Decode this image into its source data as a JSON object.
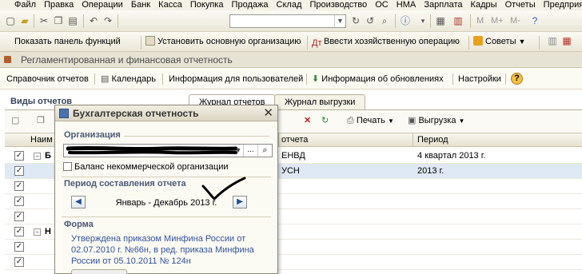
{
  "menu": [
    "Файл",
    "Правка",
    "Операции",
    "Банк",
    "Касса",
    "Покупка",
    "Продажа",
    "Склад",
    "Производство",
    "ОС",
    "НМА",
    "Зарплата",
    "Кадры",
    "Отчеты",
    "Предприятие"
  ],
  "toolbar1": {
    "icons": [
      "new-doc-icon",
      "open-icon",
      "cut-icon",
      "copy-icon",
      "paste-icon",
      "undo-icon",
      "redo-icon",
      "search-next-icon",
      "search-prev-icon",
      "search-icon",
      "info-icon",
      "calculator-icon",
      "calendar-icon",
      "m-icon",
      "m-plus-icon",
      "m-minus-icon",
      "help-icon"
    ],
    "labels": {
      "m": "M",
      "m_plus": "M+",
      "m_minus": "M-"
    },
    "search_value": ""
  },
  "toolbar2": {
    "show_panel": "Показать панель функций",
    "set_org": "Установить основную организацию",
    "enter_op": "Ввести хозяйственную операцию",
    "tips": "Советы"
  },
  "window_title": "Регламентированная и финансовая отчетность",
  "formbar": {
    "directory": "Справочник отчетов",
    "calendar": "Календарь",
    "user_info": "Информация для пользователей",
    "updates": "Информация об обновлениях",
    "settings": "Настройки"
  },
  "section_title": "Виды отчетов",
  "tabs": [
    "Журнал отчетов",
    "Журнал выгрузки"
  ],
  "listbar": {
    "print": "Печать",
    "export": "Выгрузка"
  },
  "grid": {
    "headers": {
      "name": "Наим",
      "report": "отчета",
      "period": "Период"
    },
    "rows": [
      {
        "group_prefix": "Б",
        "report": "ЕНВД",
        "period": "4 квартал 2013 г."
      },
      {
        "group_prefix": "",
        "report": "УСН",
        "period": "2013 г."
      },
      {
        "group_prefix": "",
        "report": "",
        "period": ""
      },
      {
        "group_prefix": "",
        "report": "",
        "period": ""
      },
      {
        "group_prefix": "Н",
        "report": "",
        "period": ""
      },
      {
        "group_prefix": "",
        "report": "",
        "period": ""
      }
    ]
  },
  "dialog": {
    "title": "Бухгалтерская отчетность",
    "org_label": "Организация",
    "org_value": "",
    "nonprofit_label": "Баланс некоммерческой организации",
    "period_label": "Период составления отчета",
    "period_value": "Январь - Декабрь 2013 г.",
    "form_label": "Форма",
    "form_text": "Утверждена приказом Минфина России от 02.07.2010 г. №66н, в ред. приказа Минфина России от 05.10.2011 № 124н"
  },
  "colors": {
    "accent_text": "#3053a0",
    "group_title": "#4a5a78"
  }
}
